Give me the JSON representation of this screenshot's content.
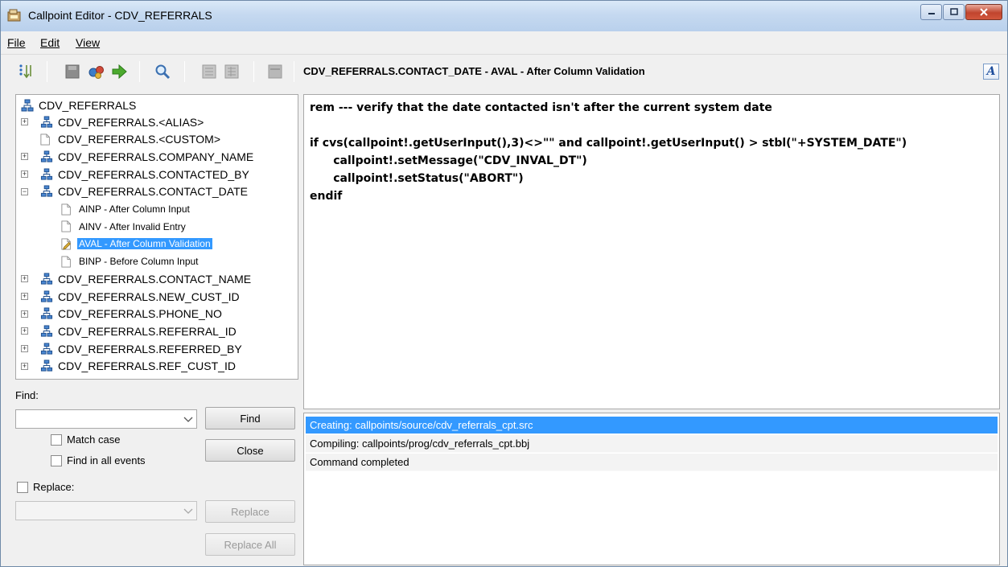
{
  "window": {
    "title": "Callpoint Editor - CDV_REFERRALS"
  },
  "menu": {
    "file": "File",
    "edit": "Edit",
    "view": "View"
  },
  "toolbar": {
    "event_title": "CDV_REFERRALS.CONTACT_DATE - AVAL  -  After Column Validation",
    "font_button": "A"
  },
  "tree": {
    "root": "CDV_REFERRALS",
    "items": [
      {
        "label": "CDV_REFERRALS.<ALIAS>",
        "expander": "+"
      },
      {
        "label": "CDV_REFERRALS.<CUSTOM>"
      },
      {
        "label": "CDV_REFERRALS.COMPANY_NAME",
        "expander": "+"
      },
      {
        "label": "CDV_REFERRALS.CONTACTED_BY",
        "expander": "+"
      },
      {
        "label": "CDV_REFERRALS.CONTACT_DATE",
        "expander": "−"
      },
      {
        "label": "AINP  -  After Column Input"
      },
      {
        "label": "AINV  -  After Invalid Entry"
      },
      {
        "label": "AVAL  -  After Column Validation"
      },
      {
        "label": "BINP  -  Before Column Input"
      },
      {
        "label": "CDV_REFERRALS.CONTACT_NAME",
        "expander": "+"
      },
      {
        "label": "CDV_REFERRALS.NEW_CUST_ID",
        "expander": "+"
      },
      {
        "label": "CDV_REFERRALS.PHONE_NO",
        "expander": "+"
      },
      {
        "label": "CDV_REFERRALS.REFERRAL_ID",
        "expander": "+"
      },
      {
        "label": "CDV_REFERRALS.REFERRED_BY",
        "expander": "+"
      },
      {
        "label": "CDV_REFERRALS.REF_CUST_ID",
        "expander": "+"
      }
    ]
  },
  "find": {
    "label": "Find:",
    "value": "",
    "find_button": "Find",
    "close_button": "Close",
    "match_case": "Match case",
    "find_all_events": "Find in all events",
    "replace_label": "Replace:",
    "replace_value": "",
    "replace_button": "Replace",
    "replace_all_button": "Replace All"
  },
  "code": {
    "lines": [
      "rem --- verify that the date contacted isn't after the current system date",
      "",
      "if cvs(callpoint!.getUserInput(),3)<>\"\" and callpoint!.getUserInput() > stbl(\"+SYSTEM_DATE\")",
      "      callpoint!.setMessage(\"CDV_INVAL_DT\")",
      "      callpoint!.setStatus(\"ABORT\")",
      "endif"
    ]
  },
  "output": {
    "lines": [
      "Creating: callpoints/source/cdv_referrals_cpt.src",
      "Compiling: callpoints/prog/cdv_referrals_cpt.bbj",
      "Command completed"
    ]
  },
  "colors": {
    "selection": "#3399ff",
    "titlebar": "#c5d9f0",
    "close": "#c0452e"
  },
  "icons": [
    "app-icon",
    "sort-icon",
    "save-icon",
    "build-icon",
    "run-arrow-icon",
    "search-icon",
    "grid-icon",
    "grid-alt-icon",
    "panel-icon",
    "font-icon",
    "tree-node-icon",
    "document-icon",
    "edit-document-icon"
  ]
}
